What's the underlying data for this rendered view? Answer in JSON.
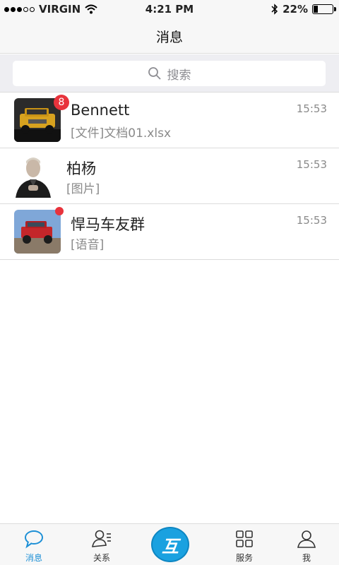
{
  "status_bar": {
    "carrier": "VIRGIN",
    "time": "4:21 PM",
    "battery": "22%",
    "battery_level": 0.22
  },
  "nav": {
    "title": "消息"
  },
  "search": {
    "placeholder": "搜索"
  },
  "chats": [
    {
      "name": "Bennett",
      "preview": "[文件]文档01.xlsx",
      "time": "15:53",
      "badge": "8",
      "avatar": "yellow-suv-avatar"
    },
    {
      "name": "柏杨",
      "preview": "[图片]",
      "time": "15:53",
      "avatar": "man-portrait-avatar"
    },
    {
      "name": "悍马车友群",
      "preview": "[语音]",
      "time": "15:53",
      "unread_dot": true,
      "avatar": "red-suv-avatar"
    }
  ],
  "tabs": [
    {
      "label": "消息",
      "icon": "chat-bubble-icon",
      "active": true
    },
    {
      "label": "关系",
      "icon": "contacts-icon"
    },
    {
      "label": "互",
      "icon": "center-logo-icon"
    },
    {
      "label": "服务",
      "icon": "grid-icon"
    },
    {
      "label": "我",
      "icon": "profile-icon"
    }
  ],
  "colors": {
    "accent": "#1e90d6",
    "badge": "#e8333c",
    "center_button": "#1aa1e0"
  }
}
